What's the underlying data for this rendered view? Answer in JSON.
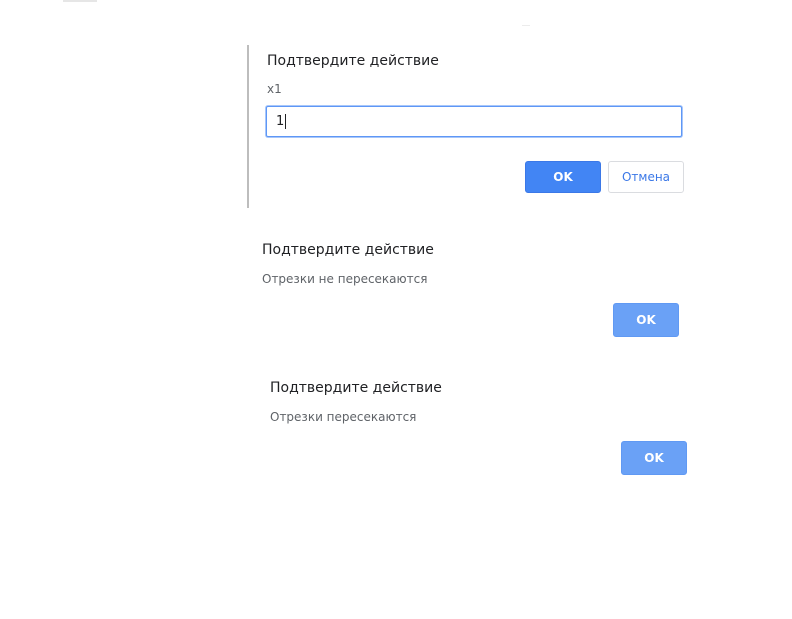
{
  "dialog_prompt": {
    "title": "Подтвердите действие",
    "message": "x1",
    "input_value": "1",
    "ok_label": "OK",
    "cancel_label": "Отмена"
  },
  "dialog_alert_1": {
    "title": "Подтвердите действие",
    "message": "Отрезки не пересекаются",
    "ok_label": "OK"
  },
  "dialog_alert_2": {
    "title": "Подтвердите действие",
    "message": "Отрезки пересекаются",
    "ok_label": "OK"
  },
  "colors": {
    "primary": "#4285f4",
    "primary_soft": "#6aa1f6",
    "focus_border": "#5e97f6"
  }
}
